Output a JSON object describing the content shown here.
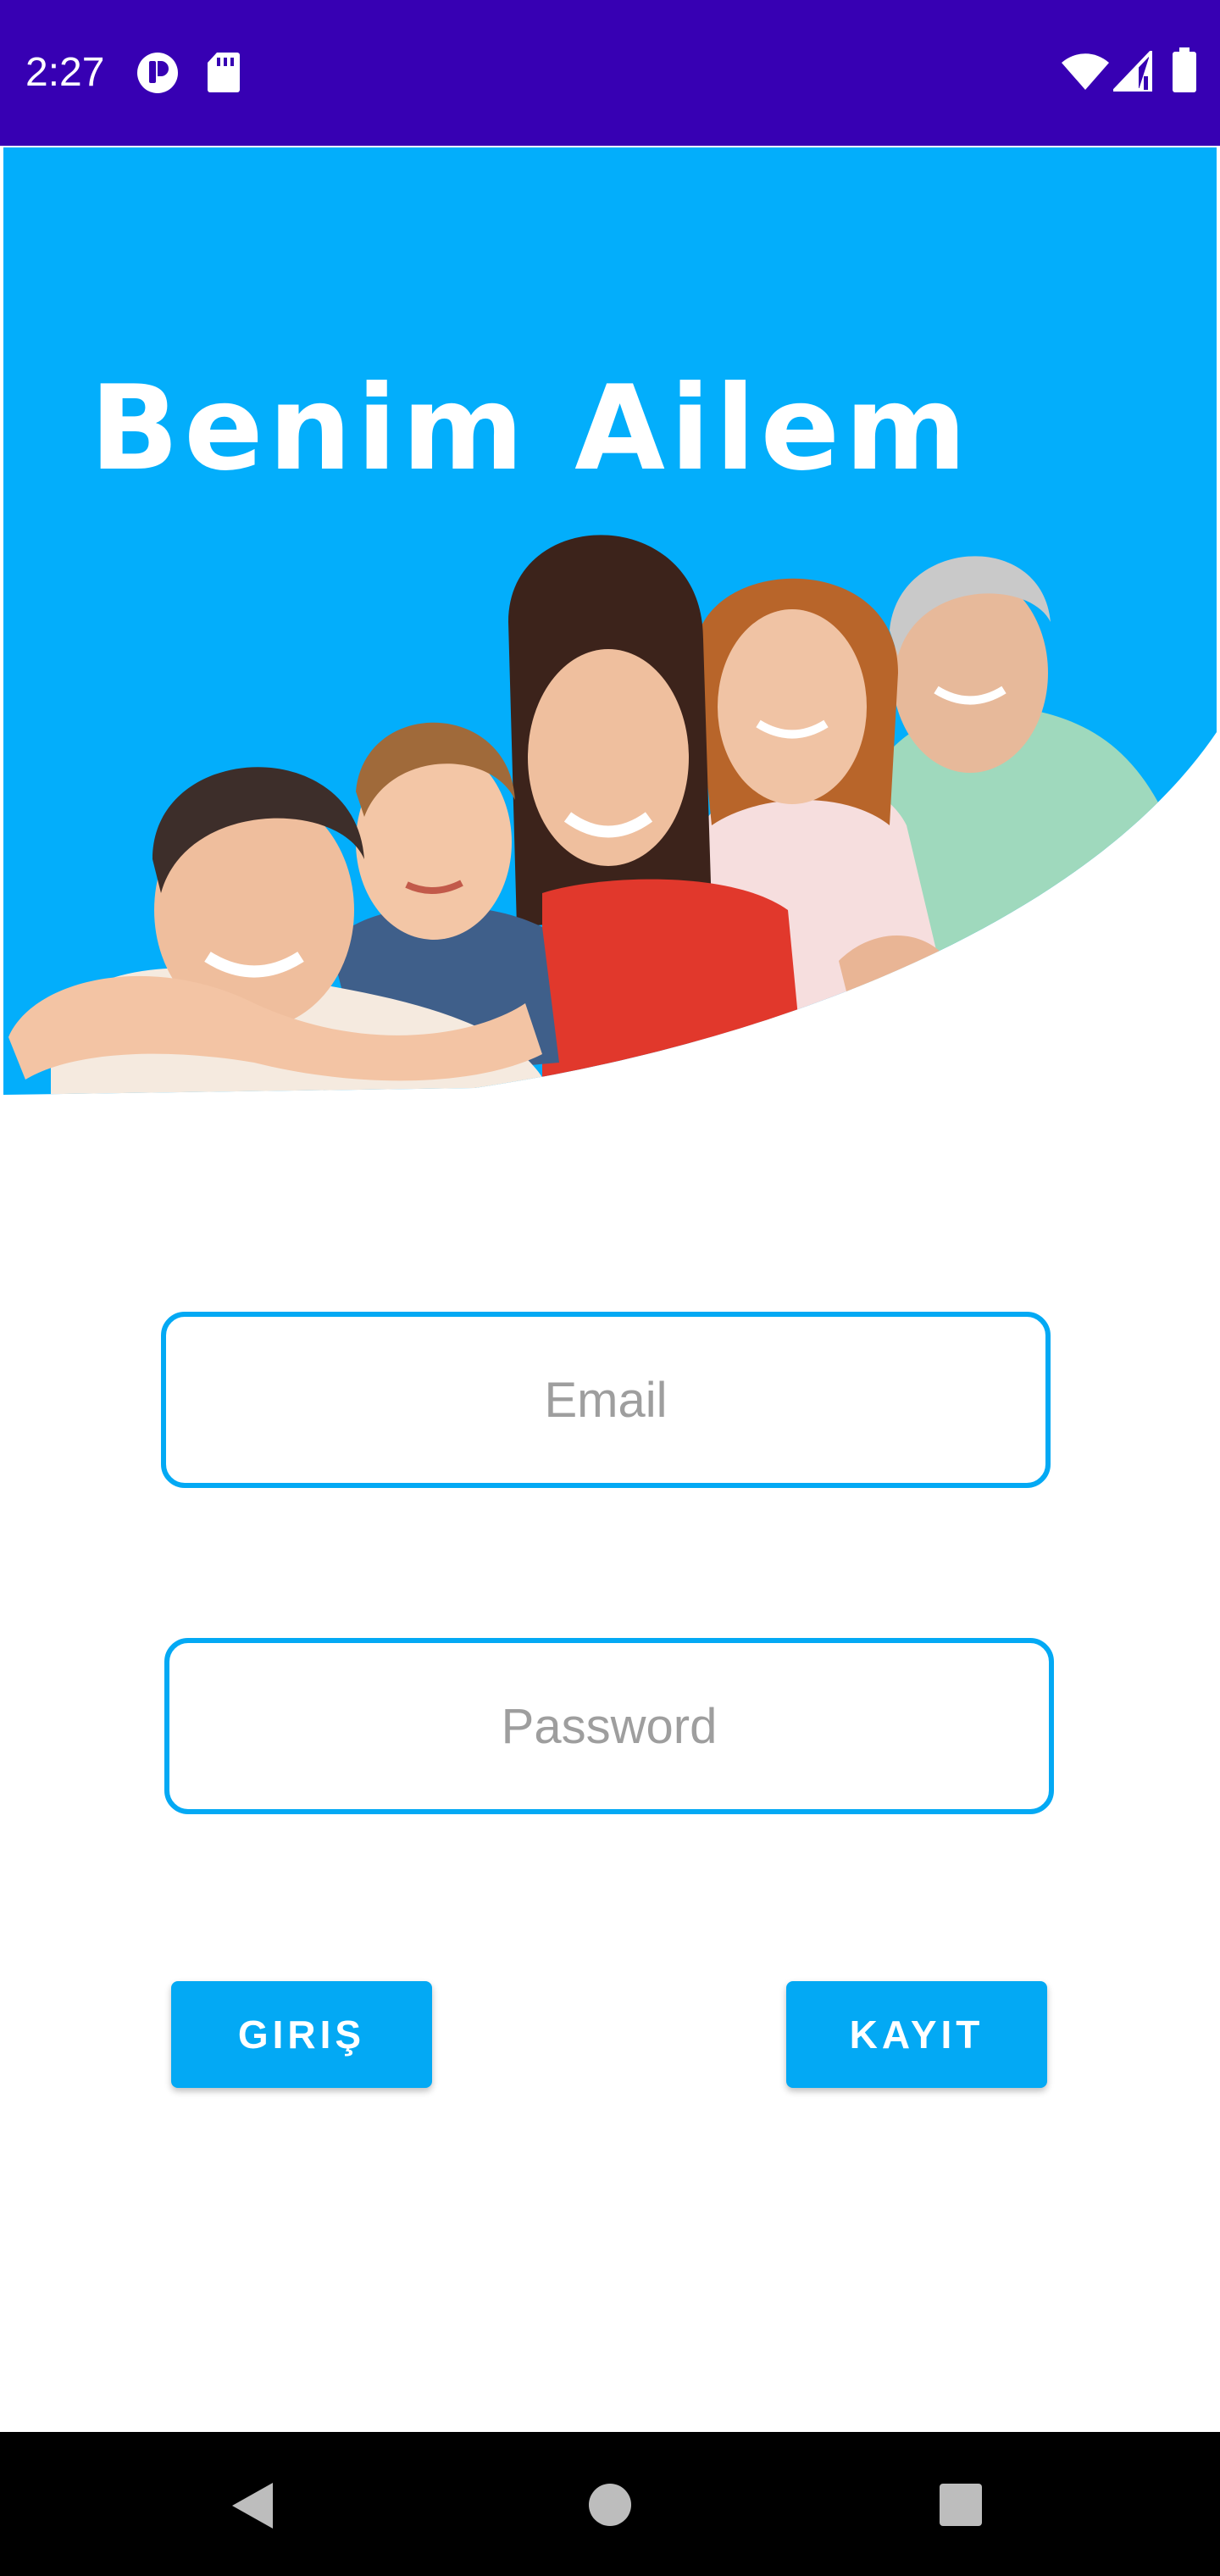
{
  "status_bar": {
    "time": "2:27",
    "icons": [
      "app-notification-icon",
      "sd-card-icon",
      "wifi-icon",
      "signal-icon",
      "battery-icon"
    ],
    "background": "#3700b3"
  },
  "hero": {
    "title": "Benim Ailem",
    "background": "#03a9f4",
    "image_description_icon": "family-photo"
  },
  "form": {
    "email": {
      "value": "",
      "placeholder": "Email"
    },
    "password": {
      "value": "",
      "placeholder": "Password"
    },
    "accent": "#03a9f4"
  },
  "actions": {
    "login_label": "GIRIŞ",
    "register_label": "KAYIT"
  },
  "nav_bar": {
    "icons": [
      "back-icon",
      "home-icon",
      "recents-icon"
    ]
  }
}
